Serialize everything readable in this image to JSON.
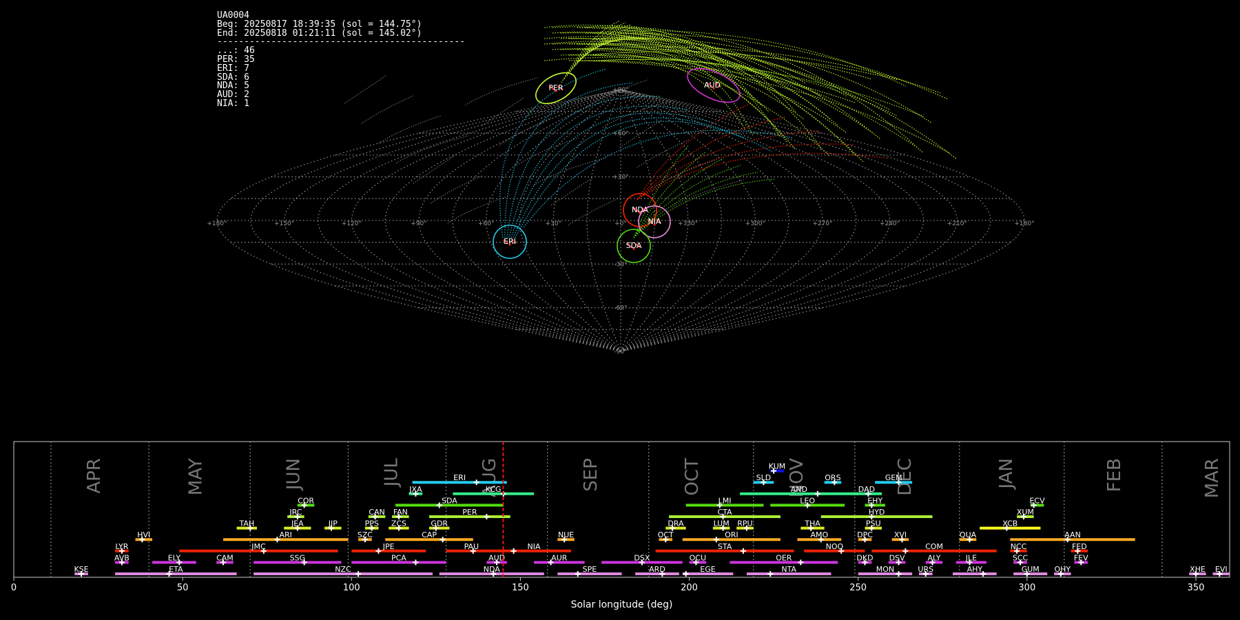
{
  "info": {
    "station": "UA0004",
    "begin": "Beg: 20250817 18:39:35 (sol = 144.75°)",
    "end": "End: 20250818 01:21:11 (sol = 145.02°)",
    "separator": "----------------------------------------------",
    "counts": [
      {
        "label": "...",
        "count": 46
      },
      {
        "label": "PER",
        "count": 35
      },
      {
        "label": "ERI",
        "count": 7
      },
      {
        "label": "SDA",
        "count": 6
      },
      {
        "label": "NDA",
        "count": 5
      },
      {
        "label": "AUD",
        "count": 2
      },
      {
        "label": "NIA",
        "count": 1
      }
    ]
  },
  "chart_data": [
    {
      "type": "scatter",
      "projection": "sinusoidal",
      "lon_ticks": [
        "+180°",
        "+150°",
        "+120°",
        "+90°",
        "+60°",
        "+30°",
        "+0°",
        "+330°",
        "+300°",
        "+270°",
        "+240°",
        "+210°",
        "+180°"
      ],
      "lat_ticks": [
        "+90°",
        "+60°",
        "+30°",
        "-30°",
        "-60°",
        "-90°"
      ],
      "radiants": [
        {
          "name": "PER",
          "color": "#ccff33"
        },
        {
          "name": "AUD",
          "color": "#cc33cc"
        },
        {
          "name": "NDA",
          "color": "#ff2200"
        },
        {
          "name": "NIA",
          "color": "#ee88dd"
        },
        {
          "name": "ERI",
          "color": "#22ccee"
        },
        {
          "name": "SDA",
          "color": "#55dd11"
        }
      ]
    },
    {
      "type": "timeline",
      "xlabel": "Solar longitude (deg)",
      "xlim": [
        0,
        360
      ],
      "xticks": [
        "0",
        "50",
        "100",
        "150",
        "200",
        "250",
        "300",
        "350"
      ],
      "current_sol": 144.9,
      "months": [
        {
          "name": "APR",
          "pos": 24
        },
        {
          "name": "MAY",
          "pos": 54
        },
        {
          "name": "JUN",
          "pos": 83
        },
        {
          "name": "JUL",
          "pos": 112
        },
        {
          "name": "AUG",
          "pos": 141
        },
        {
          "name": "SEP",
          "pos": 171
        },
        {
          "name": "OCT",
          "pos": 201
        },
        {
          "name": "NOV",
          "pos": 232
        },
        {
          "name": "DEC",
          "pos": 264
        },
        {
          "name": "JAN",
          "pos": 294
        },
        {
          "name": "FEB",
          "pos": 326
        },
        {
          "name": "MAR",
          "pos": 355
        }
      ],
      "showers": [
        {
          "code": "KUM",
          "start": 224,
          "end": 228,
          "peak": 225,
          "row": 9,
          "color": "#1111ee"
        },
        {
          "code": "ERI",
          "start": 118,
          "end": 146,
          "peak": 137,
          "row": 8,
          "color": "#22ccee"
        },
        {
          "code": "SLD",
          "start": 219,
          "end": 225,
          "peak": 222,
          "row": 8,
          "color": "#22ccee"
        },
        {
          "code": "ORS",
          "start": 240,
          "end": 245,
          "peak": 243,
          "row": 8,
          "color": "#22ccee"
        },
        {
          "code": "GEM",
          "start": 255,
          "end": 266,
          "peak": 262,
          "row": 8,
          "color": "#22ccee"
        },
        {
          "code": "JXA",
          "start": 117,
          "end": 121,
          "peak": 119,
          "row": 7,
          "color": "#33ee88"
        },
        {
          "code": "KCG",
          "start": 130,
          "end": 154,
          "peak": 145,
          "row": 7,
          "color": "#33ee88"
        },
        {
          "code": "AND",
          "start": 215,
          "end": 250,
          "peak": 238,
          "row": 7,
          "color": "#33ee88"
        },
        {
          "code": "DAD",
          "start": 248,
          "end": 257,
          "peak": 253,
          "row": 7,
          "color": "#33ee88"
        },
        {
          "code": "COR",
          "start": 84,
          "end": 89,
          "peak": 86,
          "row": 6,
          "color": "#55dd11"
        },
        {
          "code": "SDA",
          "start": 113,
          "end": 145,
          "peak": 126,
          "row": 6,
          "color": "#55dd11"
        },
        {
          "code": "LMI",
          "start": 199,
          "end": 222,
          "peak": 209,
          "row": 6,
          "color": "#55dd11"
        },
        {
          "code": "LEO",
          "start": 224,
          "end": 246,
          "peak": 235,
          "row": 6,
          "color": "#55dd11"
        },
        {
          "code": "EHY",
          "start": 252,
          "end": 258,
          "peak": 254,
          "row": 6,
          "color": "#55dd11"
        },
        {
          "code": "ECV",
          "start": 301,
          "end": 305,
          "peak": 302,
          "row": 6,
          "color": "#55dd11"
        },
        {
          "code": "JRC",
          "start": 81,
          "end": 86,
          "peak": 84,
          "row": 5,
          "color": "#aaee33"
        },
        {
          "code": "CAN",
          "start": 105,
          "end": 110,
          "peak": 107,
          "row": 5,
          "color": "#aaee33"
        },
        {
          "code": "FAN",
          "start": 112,
          "end": 117,
          "peak": 114,
          "row": 5,
          "color": "#aaee33"
        },
        {
          "code": "PER",
          "start": 123,
          "end": 147,
          "peak": 140,
          "row": 5,
          "color": "#aaee33"
        },
        {
          "code": "CTA",
          "start": 194,
          "end": 227,
          "peak": 210,
          "row": 5,
          "color": "#aaee33"
        },
        {
          "code": "HYD",
          "start": 239,
          "end": 272,
          "peak": 254,
          "row": 5,
          "color": "#aaee33"
        },
        {
          "code": "XUM",
          "start": 297,
          "end": 302,
          "peak": 299,
          "row": 5,
          "color": "#aaee33"
        },
        {
          "code": "TAH",
          "start": 66,
          "end": 72,
          "peak": 70,
          "row": 4,
          "color": "#ddee22"
        },
        {
          "code": "JEA",
          "start": 80,
          "end": 88,
          "peak": 84,
          "row": 4,
          "color": "#ddee22"
        },
        {
          "code": "JIP",
          "start": 92,
          "end": 97,
          "peak": 94,
          "row": 4,
          "color": "#ddee22"
        },
        {
          "code": "PPS",
          "start": 104,
          "end": 108,
          "peak": 106,
          "row": 4,
          "color": "#ddee22"
        },
        {
          "code": "ZCS",
          "start": 111,
          "end": 117,
          "peak": 114,
          "row": 4,
          "color": "#ddee22"
        },
        {
          "code": "GDR",
          "start": 123,
          "end": 129,
          "peak": 125,
          "row": 4,
          "color": "#ddee22"
        },
        {
          "code": "DRA",
          "start": 193,
          "end": 199,
          "peak": 195,
          "row": 4,
          "color": "#ddee22"
        },
        {
          "code": "LUM",
          "start": 207,
          "end": 212,
          "peak": 210,
          "row": 4,
          "color": "#ddee22"
        },
        {
          "code": "RPU",
          "start": 214,
          "end": 219,
          "peak": 217,
          "row": 4,
          "color": "#ddee22"
        },
        {
          "code": "THA",
          "start": 233,
          "end": 240,
          "peak": 236,
          "row": 4,
          "color": "#ddee22"
        },
        {
          "code": "PSU",
          "start": 252,
          "end": 257,
          "peak": 254,
          "row": 4,
          "color": "#ddee22"
        },
        {
          "code": "XCB",
          "start": 286,
          "end": 304,
          "peak": 294,
          "row": 4,
          "color": "#ffff22"
        },
        {
          "code": "HVI",
          "start": 36,
          "end": 41,
          "peak": 38,
          "row": 3,
          "color": "#ffaa22"
        },
        {
          "code": "ARI",
          "start": 62,
          "end": 99,
          "peak": 78,
          "row": 3,
          "color": "#ffaa22"
        },
        {
          "code": "SZC",
          "start": 102,
          "end": 106,
          "peak": 104,
          "row": 3,
          "color": "#ffaa22"
        },
        {
          "code": "CAP",
          "start": 110,
          "end": 136,
          "peak": 127,
          "row": 3,
          "color": "#ffaa22"
        },
        {
          "code": "NUE",
          "start": 161,
          "end": 166,
          "peak": 163,
          "row": 3,
          "color": "#ffaa22"
        },
        {
          "code": "OCT",
          "start": 191,
          "end": 195,
          "peak": 193,
          "row": 3,
          "color": "#ffaa22"
        },
        {
          "code": "ORI",
          "start": 198,
          "end": 227,
          "peak": 208,
          "row": 3,
          "color": "#ffaa22"
        },
        {
          "code": "AMO",
          "start": 232,
          "end": 245,
          "peak": 239,
          "row": 3,
          "color": "#ffaa22"
        },
        {
          "code": "DPC",
          "start": 250,
          "end": 254,
          "peak": 252,
          "row": 3,
          "color": "#ffaa22"
        },
        {
          "code": "XVI",
          "start": 260,
          "end": 265,
          "peak": 263,
          "row": 3,
          "color": "#ffaa22"
        },
        {
          "code": "QUA",
          "start": 280,
          "end": 285,
          "peak": 283,
          "row": 3,
          "color": "#ffaa22"
        },
        {
          "code": "AAN",
          "start": 295,
          "end": 332,
          "peak": 312,
          "row": 3,
          "color": "#ffaa22"
        },
        {
          "code": "LYR",
          "start": 30,
          "end": 34,
          "peak": 32,
          "row": 2,
          "color": "#ee2200"
        },
        {
          "code": "JMC",
          "start": 49,
          "end": 96,
          "peak": 74,
          "row": 2,
          "color": "#ee2200"
        },
        {
          "code": "JPE",
          "start": 100,
          "end": 122,
          "peak": 108,
          "row": 2,
          "color": "#ee2200"
        },
        {
          "code": "PAU",
          "start": 128,
          "end": 143,
          "peak": 136,
          "row": 2,
          "color": "#ee2200"
        },
        {
          "code": "NIA",
          "start": 143,
          "end": 165,
          "peak": 148,
          "row": 2,
          "color": "#ee2200"
        },
        {
          "code": "STA",
          "start": 190,
          "end": 231,
          "peak": 216,
          "row": 2,
          "color": "#ee2200"
        },
        {
          "code": "NOO",
          "start": 234,
          "end": 252,
          "peak": 245,
          "row": 2,
          "color": "#ee2200"
        },
        {
          "code": "COM",
          "start": 254,
          "end": 291,
          "peak": 264,
          "row": 2,
          "color": "#ee2200"
        },
        {
          "code": "NCC",
          "start": 295,
          "end": 300,
          "peak": 297,
          "row": 2,
          "color": "#ee2200"
        },
        {
          "code": "FED",
          "start": 313,
          "end": 318,
          "peak": 315,
          "row": 2,
          "color": "#ee2200"
        },
        {
          "code": "AVB",
          "start": 30,
          "end": 34,
          "peak": 32,
          "row": 1,
          "color": "#cc33dd"
        },
        {
          "code": "ELY",
          "start": 41,
          "end": 54,
          "peak": 49,
          "row": 1,
          "color": "#cc33dd"
        },
        {
          "code": "CAM",
          "start": 60,
          "end": 65,
          "peak": 62,
          "row": 1,
          "color": "#cc33dd"
        },
        {
          "code": "SSG",
          "start": 71,
          "end": 97,
          "peak": 86,
          "row": 1,
          "color": "#cc33dd"
        },
        {
          "code": "PCA",
          "start": 100,
          "end": 128,
          "peak": 119,
          "row": 1,
          "color": "#cc33dd"
        },
        {
          "code": "AUD",
          "start": 140,
          "end": 146,
          "peak": 143,
          "row": 1,
          "color": "#cc33dd"
        },
        {
          "code": "AUR",
          "start": 154,
          "end": 169,
          "peak": 159,
          "row": 1,
          "color": "#cc33dd"
        },
        {
          "code": "DSX",
          "start": 174,
          "end": 198,
          "peak": 186,
          "row": 1,
          "color": "#cc33dd"
        },
        {
          "code": "OCU",
          "start": 200,
          "end": 205,
          "peak": 202,
          "row": 1,
          "color": "#cc33dd"
        },
        {
          "code": "OER",
          "start": 212,
          "end": 244,
          "peak": 233,
          "row": 1,
          "color": "#cc33dd"
        },
        {
          "code": "DKD",
          "start": 250,
          "end": 254,
          "peak": 252,
          "row": 1,
          "color": "#cc33dd"
        },
        {
          "code": "DSV",
          "start": 259,
          "end": 264,
          "peak": 262,
          "row": 1,
          "color": "#cc33dd"
        },
        {
          "code": "ALY",
          "start": 270,
          "end": 275,
          "peak": 272,
          "row": 1,
          "color": "#cc33dd"
        },
        {
          "code": "JLE",
          "start": 279,
          "end": 288,
          "peak": 283,
          "row": 1,
          "color": "#cc33dd"
        },
        {
          "code": "SCC",
          "start": 296,
          "end": 300,
          "peak": 298,
          "row": 1,
          "color": "#cc33dd"
        },
        {
          "code": "FEV",
          "start": 314,
          "end": 318,
          "peak": 316,
          "row": 1,
          "color": "#cc33dd"
        },
        {
          "code": "KSE",
          "start": 18,
          "end": 22,
          "peak": 20,
          "row": 0,
          "color": "#dd88dd"
        },
        {
          "code": "ETA",
          "start": 30,
          "end": 66,
          "peak": 46,
          "row": 0,
          "color": "#dd88dd"
        },
        {
          "code": "NZC",
          "start": 71,
          "end": 124,
          "peak": 102,
          "row": 0,
          "color": "#dd88dd"
        },
        {
          "code": "NDA",
          "start": 126,
          "end": 157,
          "peak": 142,
          "row": 0,
          "color": "#dd88dd"
        },
        {
          "code": "SPE",
          "start": 161,
          "end": 180,
          "peak": 167,
          "row": 0,
          "color": "#dd88dd"
        },
        {
          "code": "ARD",
          "start": 184,
          "end": 197,
          "peak": 192,
          "row": 0,
          "color": "#dd88dd"
        },
        {
          "code": "EGE",
          "start": 198,
          "end": 213,
          "peak": 199,
          "row": 0,
          "color": "#dd88dd"
        },
        {
          "code": "NTA",
          "start": 217,
          "end": 242,
          "peak": 224,
          "row": 0,
          "color": "#dd88dd"
        },
        {
          "code": "MON",
          "start": 250,
          "end": 266,
          "peak": 262,
          "row": 0,
          "color": "#dd88dd"
        },
        {
          "code": "URS",
          "start": 268,
          "end": 272,
          "peak": 270,
          "row": 0,
          "color": "#dd88dd"
        },
        {
          "code": "AHY",
          "start": 278,
          "end": 291,
          "peak": 287,
          "row": 0,
          "color": "#dd88dd"
        },
        {
          "code": "GUM",
          "start": 296,
          "end": 306,
          "peak": 300,
          "row": 0,
          "color": "#dd88dd"
        },
        {
          "code": "OHY",
          "start": 308,
          "end": 313,
          "peak": 310,
          "row": 0,
          "color": "#dd88dd"
        },
        {
          "code": "XHE",
          "start": 348,
          "end": 353,
          "peak": 350,
          "row": 0,
          "color": "#dd88dd"
        },
        {
          "code": "EVI",
          "start": 355,
          "end": 360,
          "peak": 357,
          "row": 0,
          "color": "#dd88dd"
        }
      ]
    }
  ]
}
